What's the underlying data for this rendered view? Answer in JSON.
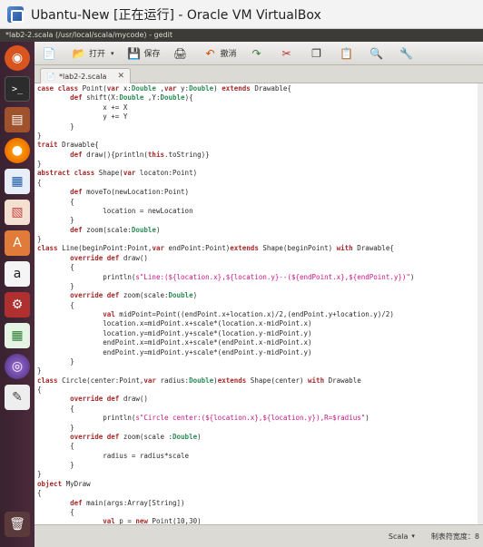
{
  "vbox": {
    "title": "Ubantu-New [正在运行] - Oracle VM VirtualBox"
  },
  "gedit": {
    "title": "*lab2-2.scala (/usr/local/scala/mycode) - gedit"
  },
  "toolbar": {
    "open_label": "打开",
    "save_label": "保存",
    "undo_label": "撤消"
  },
  "tab": {
    "label": "*lab2-2.scala"
  },
  "status": {
    "language": "Scala",
    "tab_width": "制表符宽度：8"
  },
  "code": [
    "<span class='kw'>case class</span> Point(<span class='kw'>var</span> x:<span class='ty'>Double</span> ,<span class='kw'>var</span> y:<span class='ty'>Double</span>) <span class='kw'>extends</span> Drawable{",
    "        <span class='kw'>def</span> shift(X:<span class='ty'>Double</span> ,Y:<span class='ty'>Double</span>){",
    "                x += X",
    "                y += Y",
    "        }",
    "}",
    "<span class='kw'>trait</span> Drawable{",
    "        <span class='kw'>def</span> draw(){println(<span class='kw'>this</span>.toString)}",
    "}",
    "<span class='kw'>abstract class</span> Shape(<span class='kw'>var</span> locaton:Point)",
    "{",
    "        <span class='kw'>def</span> moveTo(newLocation:Point)",
    "        {",
    "                location = newLocation",
    "        }",
    "        <span class='kw'>def</span> zoom(scale:<span class='ty'>Double</span>)",
    "}",
    "<span class='kw'>class</span> Line(beginPoint:Point,<span class='kw'>var</span> endPoint:Point)<span class='kw'>extends</span> Shape(beginPoint) <span class='kw'>with</span> Drawable{",
    "        <span class='kw'>override def</span> draw()",
    "        {",
    "                println(<span class='st'>s\"Line:(${location.x},${location.y}--(${endPoint.x},${endPoint.y})\"</span>)",
    "        }",
    "        <span class='kw'>override def</span> zoom(scale:<span class='ty'>Double</span>)",
    "        {",
    "                <span class='kw'>val</span> midPoint=Point((endPoint.x+location.x)/2,(endPoint.y+location.y)/2)",
    "                location.x=midPoint.x+scale*(location.x-midPoint.x)",
    "                location.y=midPoint.y+scale*(location.y-midPoint.y)",
    "                endPoint.x=midPoint.x+scale*(endPoint.x-midPoint.x)",
    "                endPoint.y=midPoint.y+scale*(endPoint.y-midPoint.y)",
    "        }",
    "}",
    "<span class='kw'>class</span> Circle(center:Point,<span class='kw'>var</span> radius:<span class='ty'>Double</span>)<span class='kw'>extends</span> Shape(center) <span class='kw'>with</span> Drawable",
    "{",
    "        <span class='kw'>override def</span> draw()",
    "        {",
    "                println(<span class='st'>s\"Circle center:(${location.x},${location.y}),R=$radius\"</span>)",
    "        }",
    "        <span class='kw'>override def</span> zoom(scale :<span class='ty'>Double</span>)",
    "        {",
    "                radius = radius*scale",
    "        }",
    "}",
    "<span class='kw'>object</span> MyDraw",
    "{",
    "        <span class='kw'>def</span> main(args:Array[String])",
    "        {",
    "                <span class='kw'>val</span> p = <span class='kw'>new</span> Point(10,30)"
  ]
}
